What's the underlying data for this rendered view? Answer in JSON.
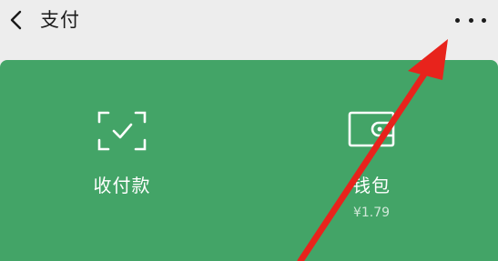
{
  "header": {
    "title": "支付",
    "back_icon": "chevron-left-icon",
    "more_icon": "more-horizontal-icon"
  },
  "pay_card": {
    "background_color": "#43a467",
    "actions": [
      {
        "label": "收付款",
        "icon": "scan-check-icon"
      },
      {
        "label": "钱包",
        "sub": "¥1.79",
        "icon": "wallet-icon"
      }
    ]
  },
  "annotation": {
    "arrow_color": "#e8231c"
  }
}
